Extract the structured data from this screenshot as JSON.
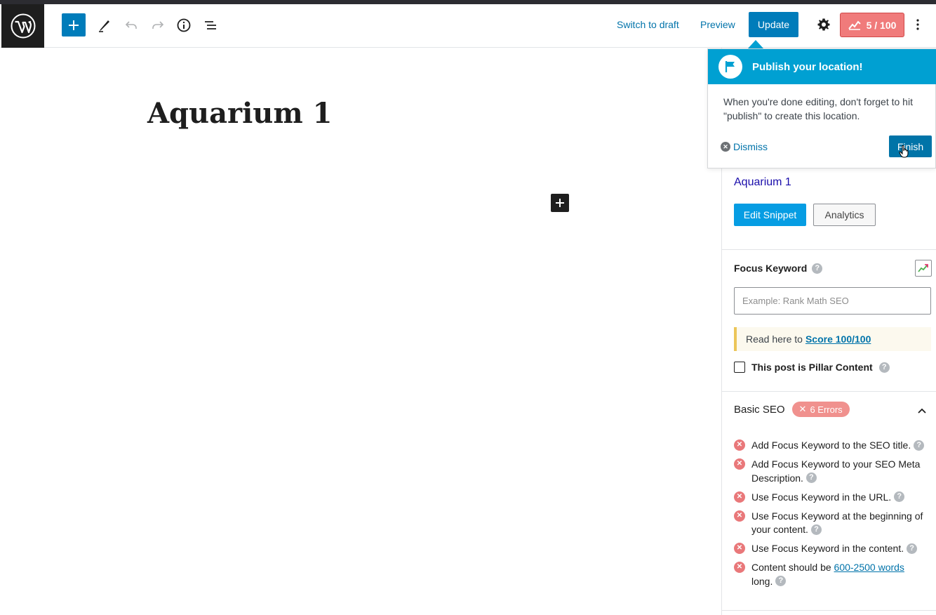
{
  "header": {
    "switch_to_draft": "Switch to draft",
    "preview": "Preview",
    "update": "Update",
    "seo_score": "5 / 100"
  },
  "editor": {
    "post_title": "Aquarium 1"
  },
  "popover": {
    "title": "Publish your location!",
    "body": "When you're done editing, don't forget to hit \"publish\" to create this location.",
    "dismiss": "Dismiss",
    "finish": "Finish"
  },
  "sidebar": {
    "snippet_title": "Aquarium 1",
    "edit_snippet": "Edit Snippet",
    "analytics": "Analytics",
    "focus_keyword_label": "Focus Keyword",
    "focus_keyword_placeholder": "Example: Rank Math SEO",
    "focus_keyword_value": "",
    "notice_text": "Read here to",
    "notice_link": "Score 100/100",
    "pillar_label": "This post is Pillar Content",
    "pillar_checked": false,
    "basic_seo": {
      "title": "Basic SEO",
      "errors_badge": "6 Errors",
      "checks": [
        {
          "text": "Add Focus Keyword to the SEO title."
        },
        {
          "text": "Add Focus Keyword to your SEO Meta Description."
        },
        {
          "text": "Use Focus Keyword in the URL."
        },
        {
          "text": "Use Focus Keyword at the beginning of your content."
        },
        {
          "text": "Use Focus Keyword in the content."
        },
        {
          "text_before": "Content should be",
          "link": "600-2500 words",
          "text_after": "long."
        }
      ]
    }
  },
  "help_glyph": "?",
  "colors": {
    "primary": "#007cba",
    "popover_header": "#00a0d2",
    "score_badge": "#f07b7b",
    "error": "#e9787a",
    "snippet_link": "#1a0dab"
  },
  "icons": [
    "wordpress-logo-icon",
    "plus-icon",
    "pencil-icon",
    "undo-icon",
    "redo-icon",
    "info-icon",
    "list-view-icon",
    "gear-icon",
    "rank-math-icon",
    "more-vertical-icon",
    "flag-icon",
    "close-circle-icon",
    "trend-icon",
    "chevron-up-icon",
    "error-x-icon",
    "help-icon"
  ]
}
